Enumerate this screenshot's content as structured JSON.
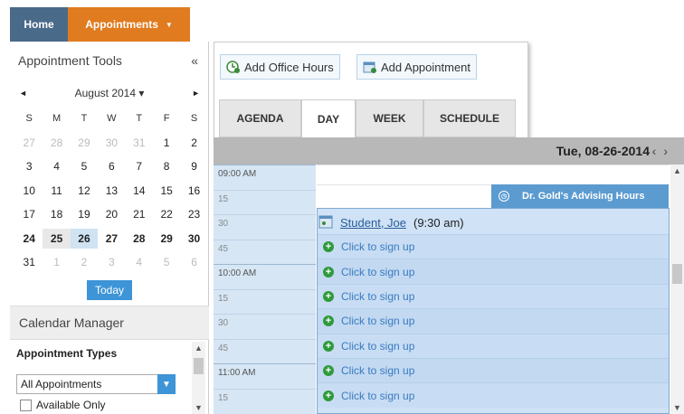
{
  "nav": {
    "home": "Home",
    "appointments": "Appointments"
  },
  "sidebar": {
    "title": "Appointment Tools",
    "collapse": "«",
    "calendar": {
      "month": "August 2014 ▾",
      "prev": "◄",
      "next": "►",
      "weekdays": [
        "S",
        "M",
        "T",
        "W",
        "T",
        "F",
        "S"
      ],
      "weeks": [
        [
          "27",
          "28",
          "29",
          "30",
          "31",
          "1",
          "2"
        ],
        [
          "3",
          "4",
          "5",
          "6",
          "7",
          "8",
          "9"
        ],
        [
          "10",
          "11",
          "12",
          "13",
          "14",
          "15",
          "16"
        ],
        [
          "17",
          "18",
          "19",
          "20",
          "21",
          "22",
          "23"
        ],
        [
          "24",
          "25",
          "26",
          "27",
          "28",
          "29",
          "30"
        ],
        [
          "31",
          "1",
          "2",
          "3",
          "4",
          "5",
          "6"
        ]
      ]
    },
    "today": "Today",
    "calendar_manager": "Calendar Manager",
    "appointment_types": "Appointment Types",
    "types_select": "All Appointments",
    "available_only": "Available Only"
  },
  "toolbar": {
    "add_office_hours": "Add Office Hours",
    "add_appointment": "Add Appointment"
  },
  "tabs": [
    {
      "label": "AGENDA"
    },
    {
      "label": "DAY"
    },
    {
      "label": "WEEK"
    },
    {
      "label": "SCHEDULE"
    }
  ],
  "day": {
    "date": "Tue, 08-26-2014",
    "prev": "‹",
    "next": "›",
    "times": [
      "09:00 AM",
      "15",
      "30",
      "45",
      "10:00 AM",
      "15",
      "30",
      "45",
      "11:00 AM",
      "15"
    ],
    "advising": "Dr. Gold's Advising Hours",
    "student_name": "Student, Joe",
    "student_time": "(9:30 am)",
    "signup": "Click to sign up"
  },
  "colors": {
    "nav_home": "#4a6a8a",
    "nav_active": "#e07b1f",
    "accent": "#3d94d6",
    "slot": "#cfe2f6"
  }
}
